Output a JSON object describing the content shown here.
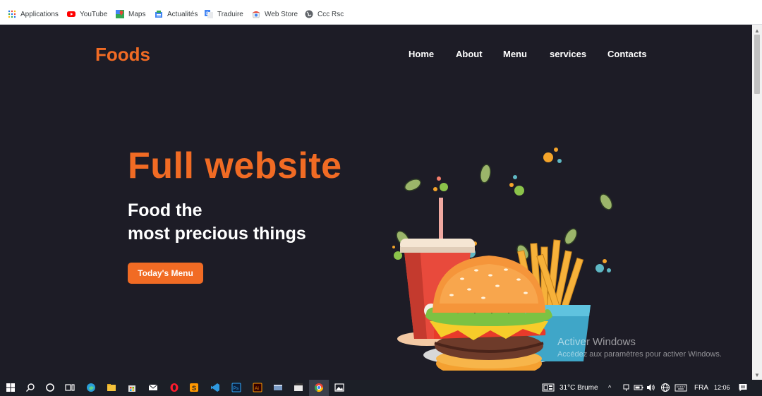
{
  "bookmarks": [
    {
      "label": "Applications",
      "icon": "apps-grid-icon"
    },
    {
      "label": "YouTube",
      "icon": "youtube-icon"
    },
    {
      "label": "Maps",
      "icon": "maps-icon"
    },
    {
      "label": "Actualités",
      "icon": "news-icon"
    },
    {
      "label": "Traduire",
      "icon": "translate-icon"
    },
    {
      "label": "Web Store",
      "icon": "web-store-icon"
    },
    {
      "label": "Ccc Rsc",
      "icon": "globe-icon"
    }
  ],
  "site": {
    "logo": "Foods",
    "nav": [
      "Home",
      "About",
      "Menu",
      "services",
      "Contacts"
    ],
    "hero_title": "Full website",
    "hero_line1": "Food the",
    "hero_line2": "most precious things",
    "cta": "Today's Menu"
  },
  "watermark": {
    "title": "Activer Windows",
    "subtitle": "Accédez aux paramètres pour activer Windows."
  },
  "taskbar": {
    "weather": "31°C  Brume",
    "language": "FRA",
    "time": "12:06"
  },
  "colors": {
    "accent": "#f16b24",
    "background": "#1d1c26",
    "text": "#ffffff"
  }
}
